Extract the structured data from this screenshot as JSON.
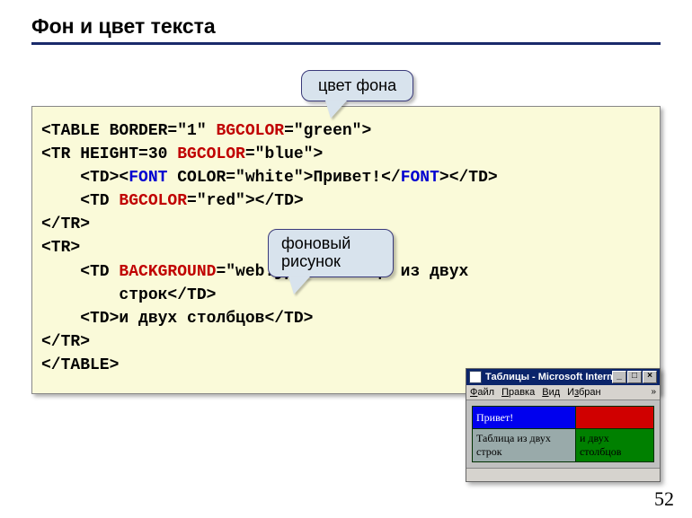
{
  "slide": {
    "title": "Фон и цвет текста",
    "page_number": "52"
  },
  "callouts": {
    "c1": "цвет фона",
    "c2": "фоновый рисунок"
  },
  "code": {
    "l1a": "<TABLE BORDER=\"1\" ",
    "l1b": "BGCOLOR",
    "l1c": "=\"green\">",
    "l2a": "<TR HEIGHT=30 ",
    "l2b": "BGCOLOR",
    "l2c": "=\"blue\">",
    "l3a": "    <TD><",
    "l3b": "FONT",
    "l3c": " COLOR=\"white\">Привет!</",
    "l3d": "FONT",
    "l3e": "></TD>",
    "l4a": "    <TD ",
    "l4b": "BGCOLOR",
    "l4c": "=\"red\"></TD>",
    "l5": "</TR>",
    "l6": "<TR>",
    "l7a": "    <TD ",
    "l7b": "BACKGROUND",
    "l7c": "=\"web.jpg\">Таблица из двух",
    "l7d": "        строк</TD>",
    "l8": "    <TD>и двух столбцов</TD>",
    "l9": "</TR>",
    "l10": "</TABLE>"
  },
  "miniwin": {
    "title": "Таблицы - Microsoft Intern...",
    "menu": {
      "file": "Файл",
      "edit": "Правка",
      "view": "Вид",
      "fav": "Избран"
    },
    "cells": {
      "c11": "Привет!",
      "c12": "",
      "c21": "Таблица из двух строк",
      "c22": "и двух столбцов"
    }
  }
}
